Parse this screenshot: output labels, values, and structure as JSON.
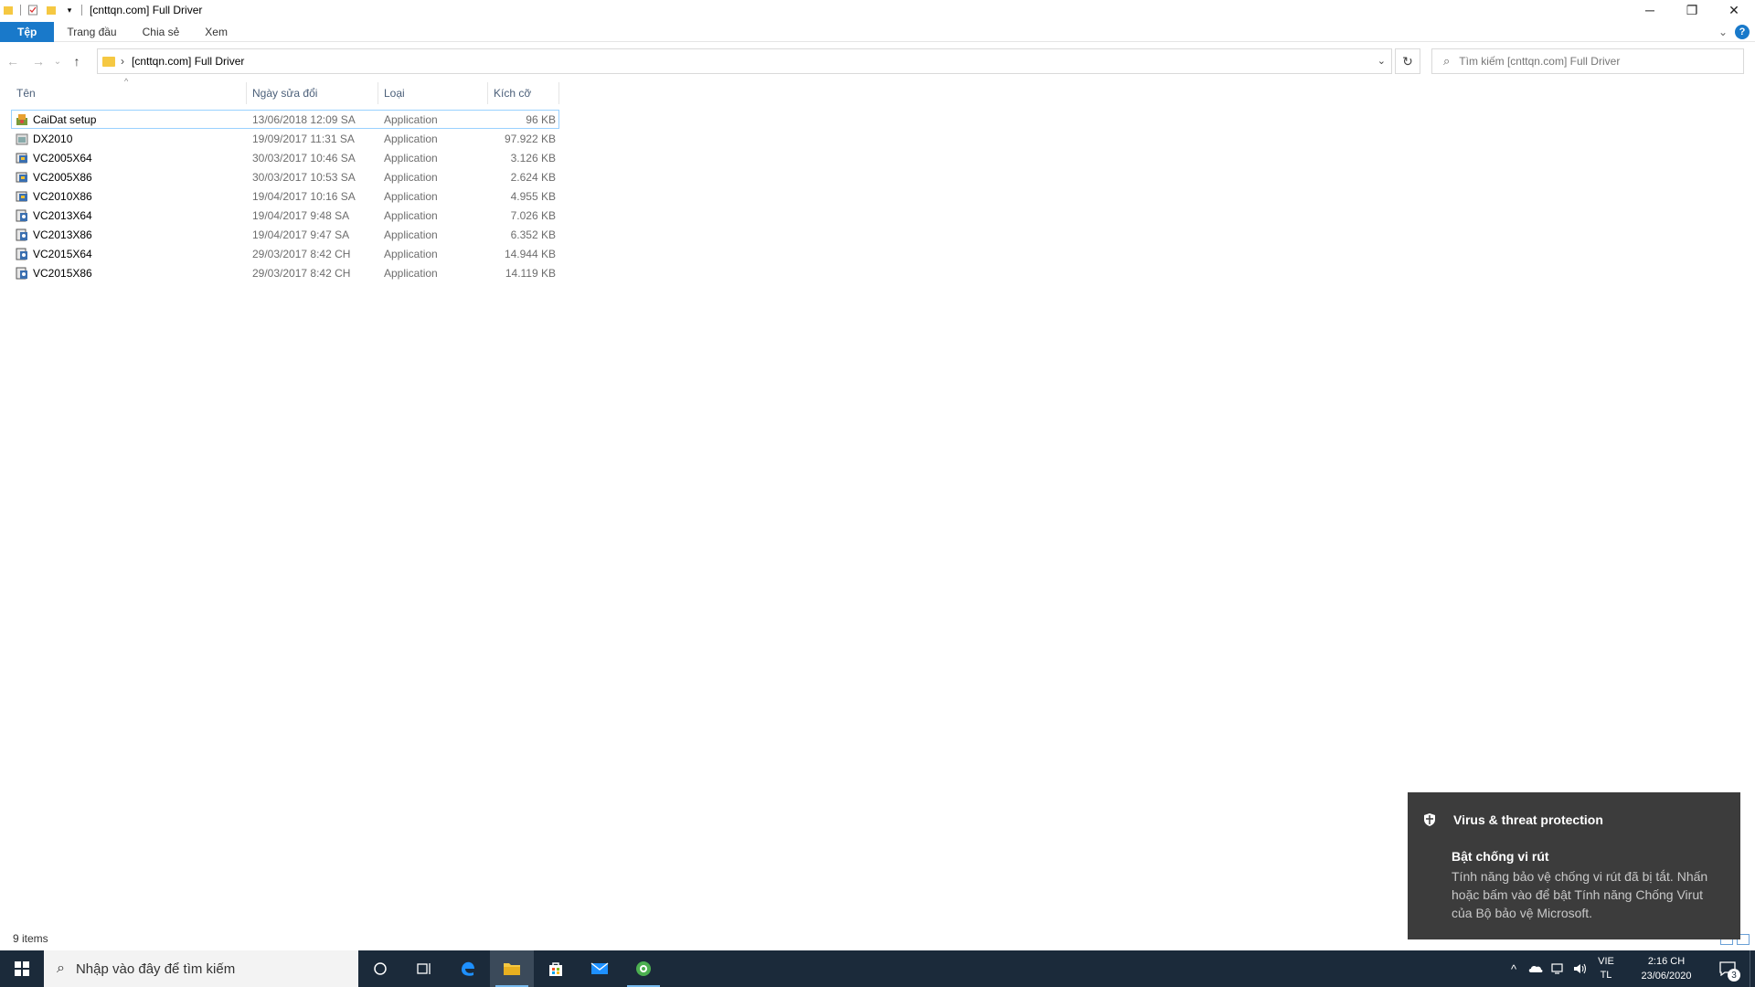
{
  "window": {
    "title": "[cnttqn.com] Full Driver",
    "controls": {
      "minimize": "─",
      "maximize": "❐",
      "close": "✕"
    }
  },
  "ribbon": {
    "tabs": [
      "Tệp",
      "Trang đầu",
      "Chia sẻ",
      "Xem"
    ],
    "help": "?",
    "expand": "⌄"
  },
  "address": {
    "path": "[cnttqn.com] Full Driver",
    "separator": "›",
    "dropdown": "⌄",
    "refresh": "↻"
  },
  "nav": {
    "back": "←",
    "forward": "→",
    "recent": "⌄",
    "up": "↑"
  },
  "search": {
    "placeholder": "Tìm kiếm [cnttqn.com] Full Driver",
    "icon": "⌕"
  },
  "columns": {
    "name": "Tên",
    "date": "Ngày sửa đổi",
    "type": "Loại",
    "size": "Kích cỡ",
    "sort": "^"
  },
  "files": [
    {
      "name": "CaiDat setup",
      "date": "13/06/2018 12:09 SA",
      "type": "Application",
      "size": "96 KB",
      "icon": "setup-icon"
    },
    {
      "name": "DX2010",
      "date": "19/09/2017 11:31 SA",
      "type": "Application",
      "size": "97.922 KB",
      "icon": "app-icon"
    },
    {
      "name": "VC2005X64",
      "date": "30/03/2017 10:46 SA",
      "type": "Application",
      "size": "3.126 KB",
      "icon": "installer-icon"
    },
    {
      "name": "VC2005X86",
      "date": "30/03/2017 10:53 SA",
      "type": "Application",
      "size": "2.624 KB",
      "icon": "installer-icon"
    },
    {
      "name": "VC2010X86",
      "date": "19/04/2017 10:16 SA",
      "type": "Application",
      "size": "4.955 KB",
      "icon": "installer-icon"
    },
    {
      "name": "VC2013X64",
      "date": "19/04/2017 9:48 SA",
      "type": "Application",
      "size": "7.026 KB",
      "icon": "installer-icon"
    },
    {
      "name": "VC2013X86",
      "date": "19/04/2017 9:47 SA",
      "type": "Application",
      "size": "6.352 KB",
      "icon": "installer-icon"
    },
    {
      "name": "VC2015X64",
      "date": "29/03/2017 8:42 CH",
      "type": "Application",
      "size": "14.944 KB",
      "icon": "installer-icon"
    },
    {
      "name": "VC2015X86",
      "date": "29/03/2017 8:42 CH",
      "type": "Application",
      "size": "14.119 KB",
      "icon": "installer-icon"
    }
  ],
  "status": {
    "items": "9 items"
  },
  "toast": {
    "app": "Virus & threat protection",
    "title": "Bật chống vi rút",
    "body": "Tính năng bảo vệ chống vi rút đã bị tắt. Nhấn hoặc bấm vào để bật Tính năng Chống Virut của Bộ bảo vệ Microsoft."
  },
  "taskbar": {
    "search_placeholder": "Nhập vào đây để tìm kiếm",
    "lang_top": "VIE",
    "lang_bottom": "TL",
    "time": "2:16 CH",
    "date": "23/06/2020",
    "notifications": "3",
    "tray_chevron": "^"
  },
  "colors": {
    "accent": "#1979ca",
    "taskbar": "#1b2a3a",
    "toast": "#3c3c3c",
    "folder": "#f5c842"
  }
}
